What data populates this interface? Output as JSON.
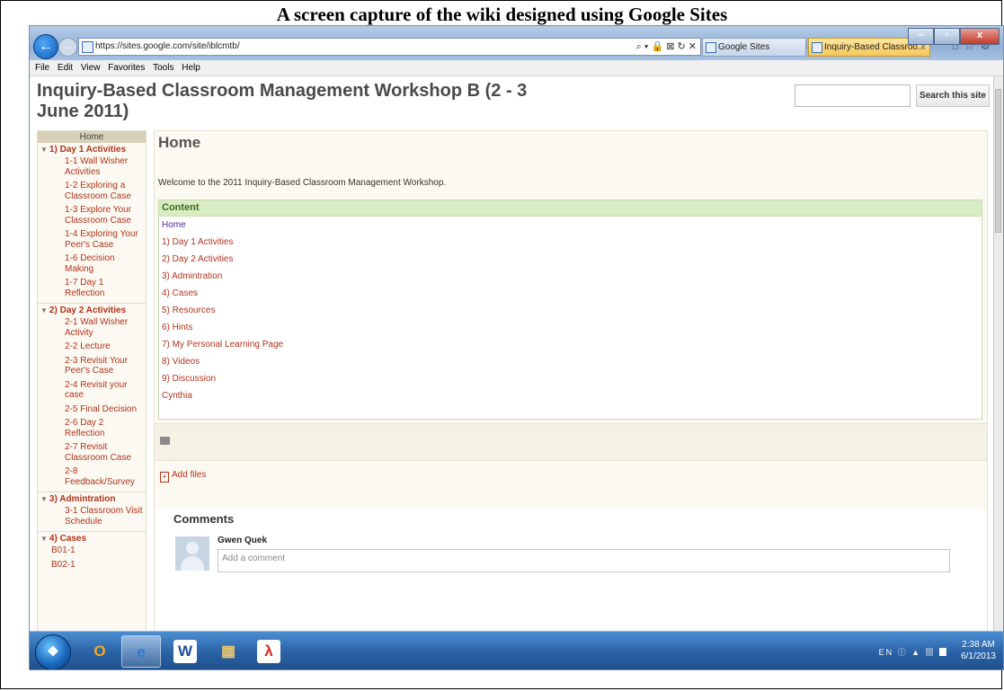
{
  "caption": "A screen capture of the wiki designed using Google Sites",
  "browser": {
    "url": "https://sites.google.com/site/iblcmtb/",
    "address_controls": "⌕ ▾ 🔒 ⊠ ↻ ✕",
    "tabs": [
      {
        "label": "Google Sites"
      },
      {
        "label": "Inquiry-Based Classroo...",
        "close": "×"
      }
    ],
    "window_buttons": {
      "minimize": "–",
      "maximize": "▫",
      "close": "x"
    },
    "menu": [
      "File",
      "Edit",
      "View",
      "Favorites",
      "Tools",
      "Help"
    ]
  },
  "site": {
    "title": "Inquiry-Based Classroom Management Workshop B (2 - 3 June 2011)",
    "search_button": "Search this site"
  },
  "sidebar": {
    "home": "Home",
    "groups": [
      {
        "label": "1) Day 1 Activities",
        "items": [
          "1-1 Wall Wisher Activities",
          "1-2 Exploring a Classroom Case",
          "1-3 Explore Your Classroom Case",
          "1-4 Exploring Your Peer's Case",
          "1-6 Decision Making",
          "1-7 Day 1 Reflection"
        ]
      },
      {
        "label": "2) Day 2 Activities",
        "items": [
          "2-1 Wall Wisher Activity",
          "2-2 Lecture",
          "2-3 Revisit Your Peer's Case",
          "2-4 Revisit your case",
          "2-5 Final Decision",
          "2-6 Day 2 Reflection",
          "2-7 Revisit Classroom Case",
          "2-8 Feedback/Survey"
        ]
      },
      {
        "label": "3) Admintration",
        "items": [
          "3-1 Classroom Visit Schedule"
        ]
      },
      {
        "label": "4) Cases",
        "items": [
          "B01-1",
          "B02-1"
        ]
      }
    ]
  },
  "main": {
    "heading": "Home",
    "welcome": "Welcome to the 2011 Inquiry-Based Classroom Management Workshop.",
    "toc_heading": "Content",
    "toc": [
      "Home",
      "1) Day 1 Activities",
      "2) Day 2 Activities",
      "3) Admintration",
      "4) Cases",
      "5) Resources",
      "6) Hints",
      "7) My Personal Learning Page",
      "8) Videos",
      "9) Discussion",
      "Cynthia"
    ],
    "add_files": "Add files",
    "comments_heading": "Comments",
    "commenter": "Gwen Quek",
    "comment_placeholder": "Add a comment"
  },
  "taskbar": {
    "apps": [
      "Outlook",
      "Internet Explorer",
      "Word",
      "File Explorer",
      "Acrobat"
    ],
    "tray": "EN",
    "time": "2:38 AM",
    "date": "6/1/2013"
  }
}
